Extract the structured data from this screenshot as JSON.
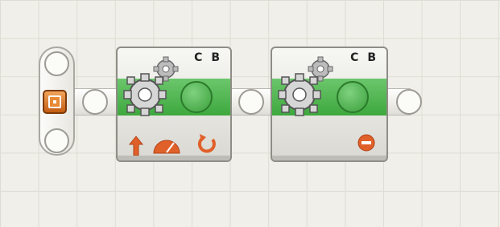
{
  "blocks": [
    {
      "label": "C B",
      "icons": [
        "up-arrow-icon",
        "speedometer-icon",
        "rotation-icon"
      ]
    },
    {
      "label": "C B",
      "icons": [
        "stop-icon"
      ]
    }
  ],
  "colors": {
    "grid_bg": "#f0efe9",
    "block_green": "#4db34d",
    "accent_orange": "#e0602a",
    "start_orange": "#d5731f"
  }
}
